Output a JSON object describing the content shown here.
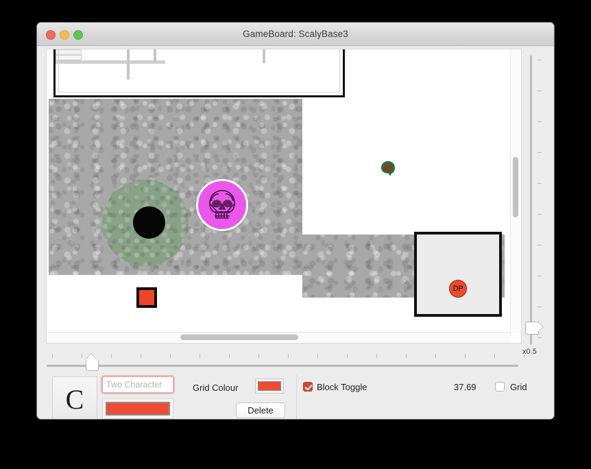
{
  "window": {
    "title": "GameBoard: ScalyBase3",
    "traffic_lights": {
      "close": "close-button",
      "minimize": "minimize-button",
      "maximize": "maximize-button"
    }
  },
  "board": {
    "tokens": [
      {
        "name": "green-disc",
        "label": "",
        "color": "#89a186"
      },
      {
        "name": "black-hole",
        "label": "",
        "color": "#050505"
      },
      {
        "name": "skull-token",
        "label": "",
        "color": "#ea57ea"
      },
      {
        "name": "red-square",
        "label": "",
        "color": "#ef4425"
      },
      {
        "name": "green-blob",
        "label": "",
        "color": "#2f6b44"
      },
      {
        "name": "dp-token",
        "label": "DP",
        "color": "#ef4a2e"
      }
    ],
    "dp_token_label": "DP"
  },
  "zoom_slider": {
    "label": "x0.5",
    "value": 0.5
  },
  "controls": {
    "preview_letter": "C",
    "name_field": {
      "value": "",
      "placeholder": "Two Character"
    },
    "token_colour": "#ef4a33",
    "grid_colour_label": "Grid Colour",
    "grid_colour": "#ef4a33",
    "delete_label": "Delete",
    "block_toggle": {
      "label": "Block Toggle",
      "checked": true,
      "color": "#cc4b37"
    },
    "numeric_value": "37.69",
    "grid_checkbox": {
      "label": "Grid",
      "checked": false
    }
  }
}
